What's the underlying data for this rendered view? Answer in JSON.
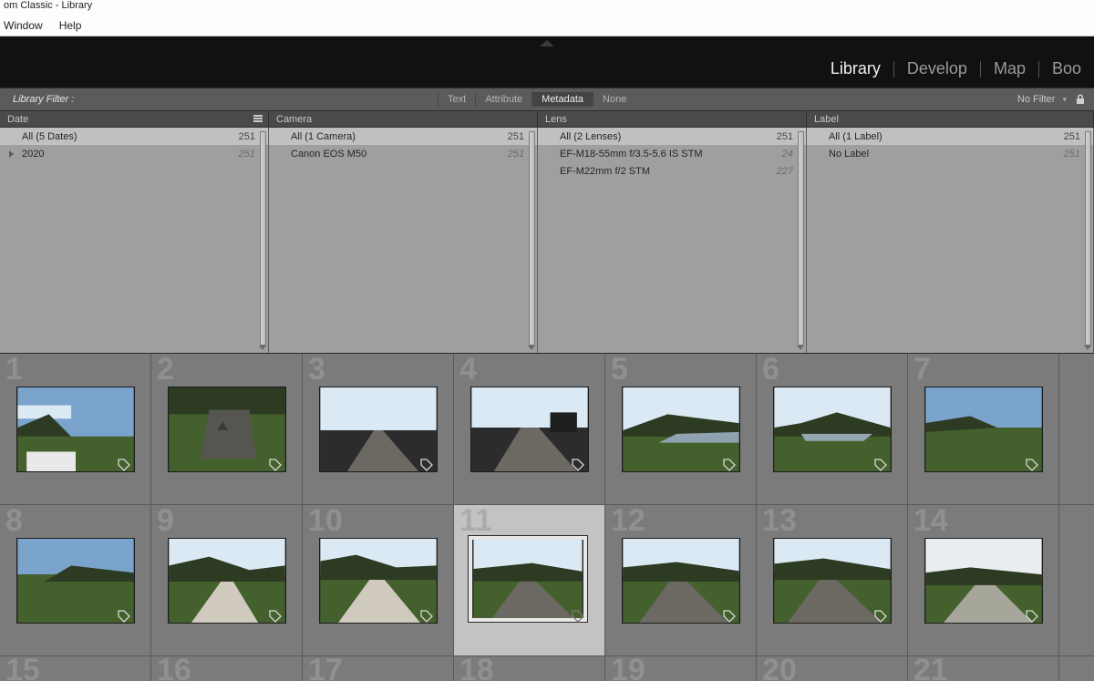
{
  "window": {
    "title_fragment": "om Classic - Library"
  },
  "menu": {
    "window": "Window",
    "help": "Help"
  },
  "modules": {
    "library": "Library",
    "develop": "Develop",
    "map": "Map",
    "book": "Boo"
  },
  "filterbar": {
    "title": "Library Filter :",
    "tabs": {
      "text": "Text",
      "attribute": "Attribute",
      "metadata": "Metadata",
      "none": "None"
    },
    "preset": "No Filter"
  },
  "columns": {
    "date": {
      "header": "Date",
      "rows": [
        {
          "label": "All (5 Dates)",
          "count": "251"
        },
        {
          "label": "2020",
          "count": "251",
          "disclosure": true
        }
      ]
    },
    "camera": {
      "header": "Camera",
      "rows": [
        {
          "label": "All (1 Camera)",
          "count": "251"
        },
        {
          "label": "Canon EOS M50",
          "count": "251"
        }
      ]
    },
    "lens": {
      "header": "Lens",
      "rows": [
        {
          "label": "All (2 Lenses)",
          "count": "251"
        },
        {
          "label": "EF-M18-55mm f/3.5-5.6 IS STM",
          "count": "24"
        },
        {
          "label": "EF-M22mm f/2 STM",
          "count": "227"
        }
      ]
    },
    "label": {
      "header": "Label",
      "rows": [
        {
          "label": "All (1 Label)",
          "count": "251"
        },
        {
          "label": "No Label",
          "count": "251"
        }
      ]
    }
  },
  "grid": {
    "row1": [
      "1",
      "2",
      "3",
      "4",
      "5",
      "6",
      "7"
    ],
    "row2": [
      "8",
      "9",
      "10",
      "11",
      "12",
      "13",
      "14"
    ],
    "row3": [
      "15",
      "16",
      "17",
      "18",
      "19",
      "20",
      "21"
    ],
    "selected_index": "11"
  }
}
